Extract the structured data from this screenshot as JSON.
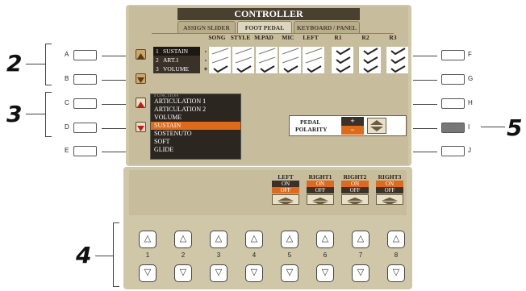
{
  "screen": {
    "title": "CONTROLLER",
    "tabs": [
      "ASSIGN SLIDER",
      "FOOT PEDAL",
      "KEYBOARD / PANEL"
    ],
    "active_tab": "FOOT PEDAL",
    "columns": [
      "SONG",
      "STYLE",
      "M.PAD",
      "MIC",
      "LEFT",
      "R1",
      "R2",
      "R3"
    ],
    "rows": [
      {
        "num": "1",
        "name": "SUSTAIN",
        "sign": "-",
        "checks": [
          false,
          false,
          false,
          false,
          false,
          true,
          true,
          true
        ]
      },
      {
        "num": "2",
        "name": "ART.1",
        "sign": "-",
        "checks": [
          false,
          false,
          false,
          false,
          false,
          true,
          true,
          true
        ]
      },
      {
        "num": "3",
        "name": "VOLUME",
        "sign": "+",
        "checks": [
          true,
          true,
          true,
          true,
          true,
          true,
          true,
          true
        ]
      }
    ],
    "function_list": {
      "items": [
        "FUNCTION",
        "ARTICULATION 1",
        "ARTICULATION 2",
        "VOLUME",
        "SUSTAIN",
        "SOSTENUTO",
        "SOFT",
        "GLIDE"
      ],
      "selected": "SUSTAIN"
    },
    "polarity": {
      "label_line1": "PEDAL",
      "label_line2": "POLARITY",
      "plus": "+",
      "minus": "−"
    },
    "parts": [
      {
        "name": "LEFT",
        "on": "ON",
        "off": "OFF",
        "selected": "OFF"
      },
      {
        "name": "RIGHT1",
        "on": "ON",
        "off": "OFF",
        "selected": "ON"
      },
      {
        "name": "RIGHT2",
        "on": "ON",
        "off": "OFF",
        "selected": "ON"
      },
      {
        "name": "RIGHT3",
        "on": "ON",
        "off": "OFF",
        "selected": "ON"
      }
    ]
  },
  "left_buttons": [
    "A",
    "B",
    "C",
    "D",
    "E"
  ],
  "right_buttons": [
    "F",
    "G",
    "H",
    "I",
    "J"
  ],
  "callouts": [
    "2",
    "3",
    "4",
    "5"
  ],
  "bottom_buttons": [
    "1",
    "2",
    "3",
    "4",
    "5",
    "6",
    "7",
    "8"
  ],
  "colors": {
    "highlight": "#e06a18",
    "screen_bg": "#c7bd9c",
    "title_bar": "#4a4030"
  }
}
